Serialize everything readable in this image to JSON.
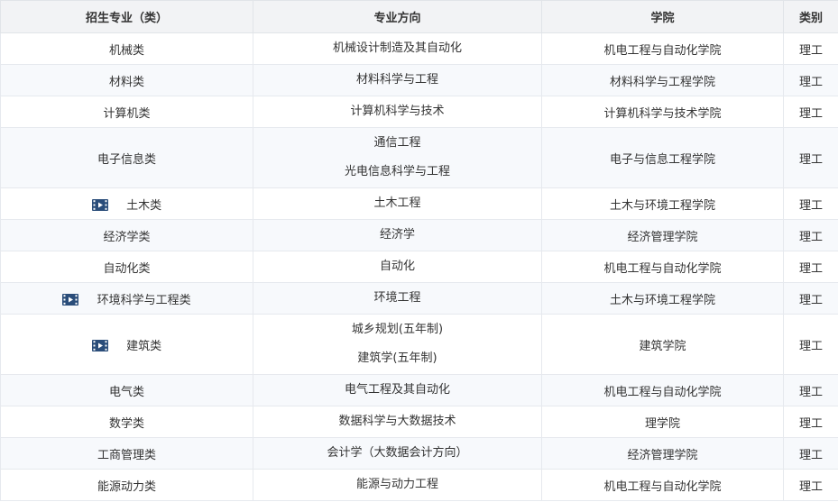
{
  "table": {
    "headers": [
      "招生专业（类）",
      "专业方向",
      "学院",
      "类别"
    ],
    "rows": [
      {
        "major": "机械类",
        "directions": [
          "机械设计制造及其自动化"
        ],
        "college": "机电工程与自动化学院",
        "category": "理工",
        "video": false
      },
      {
        "major": "材料类",
        "directions": [
          "材料科学与工程"
        ],
        "college": "材料科学与工程学院",
        "category": "理工",
        "video": false
      },
      {
        "major": "计算机类",
        "directions": [
          "计算机科学与技术"
        ],
        "college": "计算机科学与技术学院",
        "category": "理工",
        "video": false
      },
      {
        "major": "电子信息类",
        "directions": [
          "通信工程",
          "光电信息科学与工程"
        ],
        "college": "电子与信息工程学院",
        "category": "理工",
        "video": false
      },
      {
        "major": "土木类",
        "directions": [
          "土木工程"
        ],
        "college": "土木与环境工程学院",
        "category": "理工",
        "video": true
      },
      {
        "major": "经济学类",
        "directions": [
          "经济学"
        ],
        "college": "经济管理学院",
        "category": "理工",
        "video": false
      },
      {
        "major": "自动化类",
        "directions": [
          "自动化"
        ],
        "college": "机电工程与自动化学院",
        "category": "理工",
        "video": false
      },
      {
        "major": "环境科学与工程类",
        "directions": [
          "环境工程"
        ],
        "college": "土木与环境工程学院",
        "category": "理工",
        "video": true
      },
      {
        "major": "建筑类",
        "directions": [
          "城乡规划(五年制)",
          "建筑学(五年制)"
        ],
        "college": "建筑学院",
        "category": "理工",
        "video": true
      },
      {
        "major": "电气类",
        "directions": [
          "电气工程及其自动化"
        ],
        "college": "机电工程与自动化学院",
        "category": "理工",
        "video": false
      },
      {
        "major": "数学类",
        "directions": [
          "数据科学与大数据技术"
        ],
        "college": "理学院",
        "category": "理工",
        "video": false
      },
      {
        "major": "工商管理类",
        "directions": [
          "会计学（大数据会计方向）"
        ],
        "college": "经济管理学院",
        "category": "理工",
        "video": false
      },
      {
        "major": "能源动力类",
        "directions": [
          "能源与动力工程"
        ],
        "college": "机电工程与自动化学院",
        "category": "理工",
        "video": false
      }
    ]
  },
  "icons": {
    "video": "video-film-icon"
  },
  "colors": {
    "icon": "#2a4d7a",
    "header_bg": "#f2f3f5",
    "alt_row_bg": "#f7f9fc",
    "border": "#e6e9ee"
  }
}
